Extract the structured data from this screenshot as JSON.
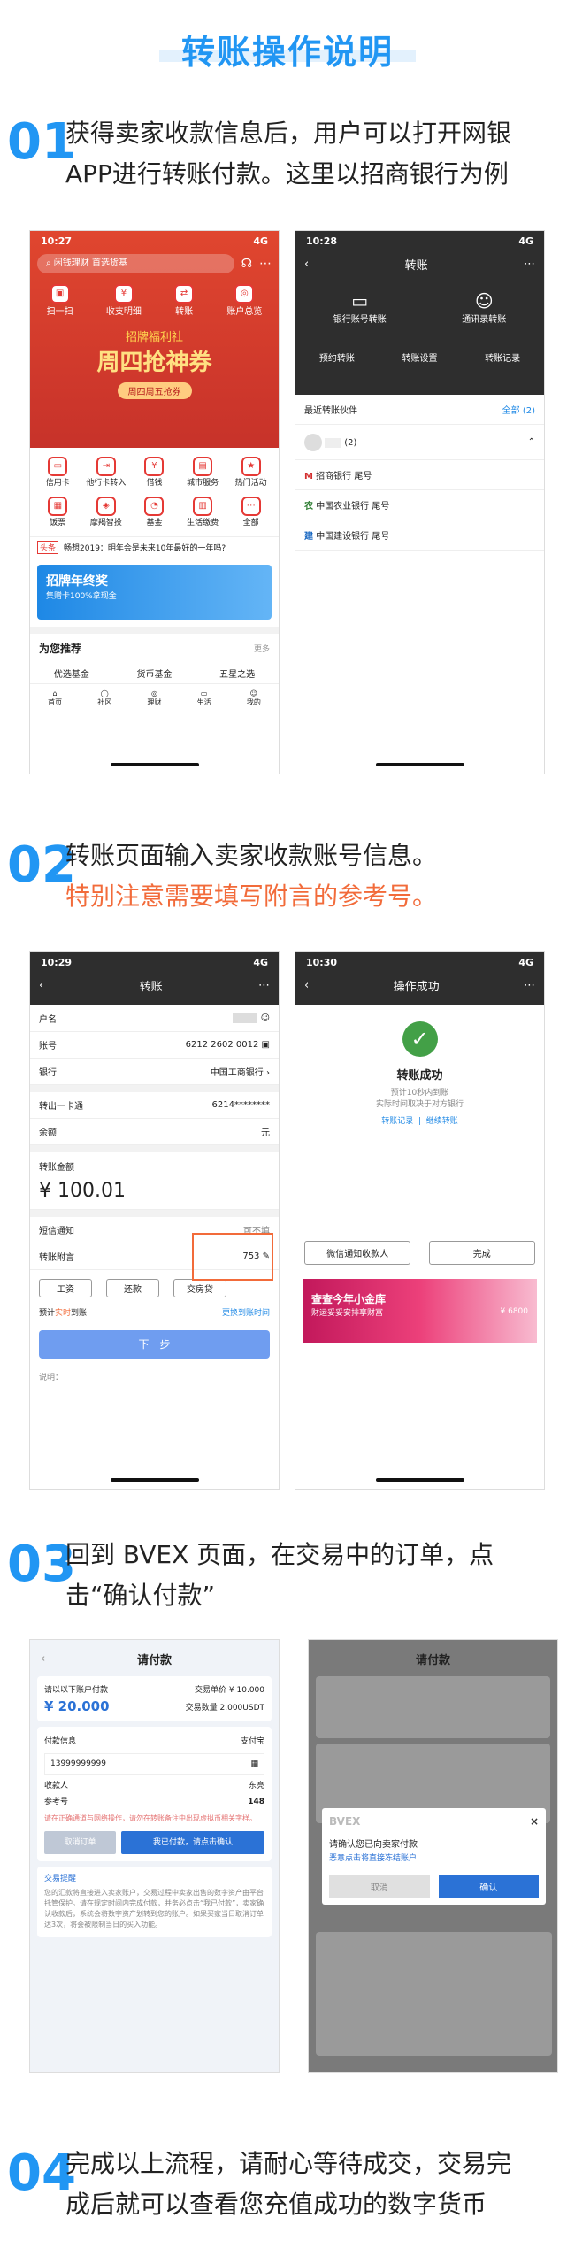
{
  "title": "转账操作说明",
  "steps": [
    {
      "num": "01",
      "line1": "获得卖家收款信息后，用户可以打开网银",
      "line2": "APP进行转账付款。这里以招商银行为例"
    },
    {
      "num": "02",
      "line1": "转账页面输入卖家收款账号信息。",
      "line2": "特别注意需要填写附言的参考号。"
    },
    {
      "num": "03",
      "line1": "回到 BVEX 页面，在交易中的订单，点",
      "line2": "击“确认付款”"
    },
    {
      "num": "04",
      "line1": "完成以上流程，请耐心等待成交，交易完",
      "line2": "成后就可以查看您充值成功的数字货币"
    }
  ],
  "p1": {
    "time": "10:27",
    "signal": "4G",
    "search": "闲钱理财 首选货基",
    "quick": [
      "扫一扫",
      "收支明细",
      "转账",
      "账户总览"
    ],
    "banner1": "招牌福利社",
    "banner2": "周四抢神券",
    "banner3": "周四周五抢券",
    "grid": [
      "信用卡",
      "他行卡转入",
      "借钱",
      "城市服务",
      "热门活动",
      "饭票",
      "摩羯智投",
      "基金",
      "生活缴费",
      "全部"
    ],
    "news_tag": "头条",
    "news": "畅想2019：明年会是未来10年最好的一年吗?",
    "promo1": "招牌年终奖",
    "promo2": "集赠卡100%拿现金",
    "rec": "为您推荐",
    "rec_more": "更多",
    "tabs": [
      "优选基金",
      "货币基金",
      "五星之选"
    ],
    "nav": [
      "首页",
      "社区",
      "理财",
      "生活",
      "我的"
    ]
  },
  "p2": {
    "time": "10:28",
    "signal": "4G",
    "header": "转账",
    "opt1": "银行账号转账",
    "opt2": "通讯录转账",
    "tabs": [
      "预约转账",
      "转账设置",
      "转账记录"
    ],
    "recent": "最近转账伙伴",
    "all": "全部 (2)",
    "group": "(2)",
    "partners": [
      {
        "name": "招商银行 尾号",
        "color": "#d32f2f",
        "ch": "M"
      },
      {
        "name": "中国农业银行 尾号",
        "color": "#2e7d32",
        "ch": "农"
      },
      {
        "name": "中国建设银行 尾号",
        "color": "#1565c0",
        "ch": "建"
      }
    ]
  },
  "p3": {
    "time": "10:29",
    "signal": "4G",
    "header": "转账",
    "rows": [
      {
        "k": "户名",
        "v": ""
      },
      {
        "k": "账号",
        "v": "6212 2602 0012"
      },
      {
        "k": "银行",
        "v": "中国工商银行"
      }
    ],
    "from_k": "转出一卡通",
    "from_v": "6214********",
    "bal_k": "余额",
    "bal_v": "元",
    "amt_k": "转账金额",
    "amt_v": "¥ 100.01",
    "sms_k": "短信通知",
    "sms_v": "可不填",
    "memo_k": "转账附言",
    "memo_v": "753",
    "chips": [
      "工资",
      "还款",
      "交房贷"
    ],
    "eta": "预计",
    "eta_hi": "实时",
    "eta2": "到账",
    "change": "更换到账时间",
    "next": "下一步",
    "note": "说明："
  },
  "p4": {
    "time": "10:30",
    "signal": "4G",
    "header": "操作成功",
    "ok": "转账成功",
    "sub1": "预计10秒内到账",
    "sub2": "实际时间取决于对方银行",
    "link1": "转账记录",
    "link2": "继续转账",
    "btn1": "微信通知收款人",
    "btn2": "完成",
    "ad1": "查查今年小金库",
    "ad2": "财运妥妥安排享财富",
    "ad3": "¥ 6800"
  },
  "p5": {
    "header": "请付款",
    "pay_label": "请以以下账户付款",
    "amount": "¥ 20.000",
    "price_k": "交易单价",
    "price_v": "¥ 10.000",
    "qty_k": "交易数量",
    "qty_v": "2.000USDT",
    "info": "付款信息",
    "method": "支付宝",
    "phone": "13999999999",
    "payee_k": "收款人",
    "payee_v": "东亮",
    "ref_k": "参考号",
    "ref_v": "148",
    "warn": "请在正确通道与网络操作，请勿在转账备注中出现虚拟币相关字样。",
    "cancel": "取消订单",
    "confirm": "我已付款，请点击确认",
    "tip_t": "交易提醒",
    "tip": "您的汇款将直接进入卖家账户，交易过程中卖家出售的数字资产由平台托管保护。请在规定时间内完成付款，并务必点击“我已付款”，卖家确认收款后，系统会将数字资产划转到您的账户。如果买家当日取消订单达3次，将会被限制当日的买入功能。"
  },
  "p6": {
    "header": "请付款",
    "brand": "BVEX",
    "q": "请确认您已向卖家付款",
    "warn": "恶意点击将直接冻结账户",
    "cancel": "取消",
    "ok": "确认"
  }
}
